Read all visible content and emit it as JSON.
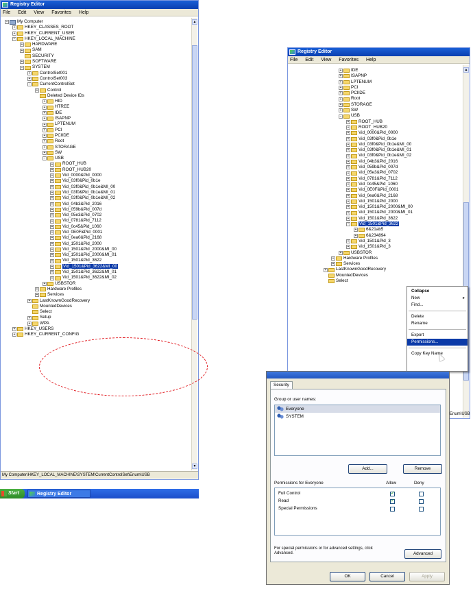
{
  "left_window": {
    "title": "Registry Editor",
    "menu": [
      "File",
      "Edit",
      "View",
      "Favorites",
      "Help"
    ],
    "tree": [
      {
        "label": "My Computer",
        "indent": 0,
        "exp": "-",
        "icon": "pc"
      },
      {
        "label": "HKEY_CLASSES_ROOT",
        "indent": 1,
        "exp": "+"
      },
      {
        "label": "HKEY_CURRENT_USER",
        "indent": 1,
        "exp": "+"
      },
      {
        "label": "HKEY_LOCAL_MACHINE",
        "indent": 1,
        "exp": "-"
      },
      {
        "label": "HARDWARE",
        "indent": 2,
        "exp": "+"
      },
      {
        "label": "SAM",
        "indent": 2,
        "exp": "+"
      },
      {
        "label": "SECURITY",
        "indent": 2,
        "exp": ""
      },
      {
        "label": "SOFTWARE",
        "indent": 2,
        "exp": "+"
      },
      {
        "label": "SYSTEM",
        "indent": 2,
        "exp": "-"
      },
      {
        "label": "ControlSet001",
        "indent": 3,
        "exp": "+"
      },
      {
        "label": "ControlSet003",
        "indent": 3,
        "exp": "+"
      },
      {
        "label": "CurrentControlSet",
        "indent": 3,
        "exp": "-"
      },
      {
        "label": "Control",
        "indent": 4,
        "exp": "+"
      },
      {
        "label": "Deleted Device IDs",
        "indent": 4,
        "exp": ""
      },
      {
        "label": "HID",
        "indent": 5,
        "exp": "+"
      },
      {
        "label": "HTREE",
        "indent": 5,
        "exp": "+"
      },
      {
        "label": "IDE",
        "indent": 5,
        "exp": "+"
      },
      {
        "label": "ISAPNP",
        "indent": 5,
        "exp": "+"
      },
      {
        "label": "LPTENUM",
        "indent": 5,
        "exp": "+"
      },
      {
        "label": "PCI",
        "indent": 5,
        "exp": "+"
      },
      {
        "label": "PCIIDE",
        "indent": 5,
        "exp": "+"
      },
      {
        "label": "Root",
        "indent": 5,
        "exp": "+"
      },
      {
        "label": "STORAGE",
        "indent": 5,
        "exp": "+"
      },
      {
        "label": "SW",
        "indent": 5,
        "exp": "+"
      },
      {
        "label": "USB",
        "indent": 5,
        "exp": "-"
      },
      {
        "label": "ROOT_HUB",
        "indent": 6,
        "exp": "+"
      },
      {
        "label": "ROOT_HUB20",
        "indent": 6,
        "exp": "+"
      },
      {
        "label": "Vid_0000&Pid_0000",
        "indent": 6,
        "exp": "+"
      },
      {
        "label": "Vid_03f0&Pid_0b1e",
        "indent": 6,
        "exp": "+"
      },
      {
        "label": "Vid_03f0&Pid_0b1e&MI_00",
        "indent": 6,
        "exp": "+"
      },
      {
        "label": "Vid_03f0&Pid_0b1e&MI_01",
        "indent": 6,
        "exp": "+"
      },
      {
        "label": "Vid_03f0&Pid_0b1e&MI_02",
        "indent": 6,
        "exp": "+"
      },
      {
        "label": "Vid_04b3&Pid_2016",
        "indent": 6,
        "exp": "+"
      },
      {
        "label": "Vid_059b&Pid_007d",
        "indent": 6,
        "exp": "+"
      },
      {
        "label": "Vid_05e3&Pid_0702",
        "indent": 6,
        "exp": "+"
      },
      {
        "label": "Vid_0781&Pid_7112",
        "indent": 6,
        "exp": "+"
      },
      {
        "label": "Vid_0c45&Pid_1060",
        "indent": 6,
        "exp": "+"
      },
      {
        "label": "Vid_0E0F&Pid_0001",
        "indent": 6,
        "exp": "+"
      },
      {
        "label": "Vid_0ea0&Pid_2168",
        "indent": 6,
        "exp": "+"
      },
      {
        "label": "Vid_1501&Pid_2000",
        "indent": 6,
        "exp": "+"
      },
      {
        "label": "Vid_1501&Pid_2000&MI_00",
        "indent": 6,
        "exp": "+"
      },
      {
        "label": "Vid_1501&Pid_2000&MI_01",
        "indent": 6,
        "exp": "+"
      },
      {
        "label": "Vid_1501&Pid_3622",
        "indent": 6,
        "exp": "+"
      },
      {
        "label": "Vid_1501&Pid_3622&MI_00",
        "indent": 6,
        "exp": "+",
        "selected": true
      },
      {
        "label": "Vid_1501&Pid_3622&MI_01",
        "indent": 6,
        "exp": "+"
      },
      {
        "label": "Vid_1501&Pid_3622&MI_02",
        "indent": 6,
        "exp": "+"
      },
      {
        "label": "USBSTOR",
        "indent": 5,
        "exp": "+"
      },
      {
        "label": "Hardware Profiles",
        "indent": 4,
        "exp": "+"
      },
      {
        "label": "Services",
        "indent": 4,
        "exp": "+"
      },
      {
        "label": "LastKnownGoodRecovery",
        "indent": 3,
        "exp": "+"
      },
      {
        "label": "MountedDevices",
        "indent": 3,
        "exp": ""
      },
      {
        "label": "Select",
        "indent": 3,
        "exp": ""
      },
      {
        "label": "Setup",
        "indent": 3,
        "exp": "+"
      },
      {
        "label": "WPA",
        "indent": 3,
        "exp": "+"
      },
      {
        "label": "HKEY_USERS",
        "indent": 1,
        "exp": "+"
      },
      {
        "label": "HKEY_CURRENT_CONFIG",
        "indent": 1,
        "exp": "+"
      }
    ],
    "status": "My Computer\\HKEY_LOCAL_MACHINE\\SYSTEM\\CurrentControlSet\\Enum\\USB",
    "start_label": "Start",
    "taskbar_item": "Registry Editor"
  },
  "right_window": {
    "title": "Registry Editor",
    "menu": [
      "File",
      "Edit",
      "View",
      "Favorites",
      "Help"
    ],
    "tree": [
      {
        "label": "IDE",
        "indent": 1,
        "exp": "+"
      },
      {
        "label": "ISAPNP",
        "indent": 1,
        "exp": "+"
      },
      {
        "label": "LPTENUM",
        "indent": 1,
        "exp": "+"
      },
      {
        "label": "PCI",
        "indent": 1,
        "exp": "+"
      },
      {
        "label": "PCIIDE",
        "indent": 1,
        "exp": "+"
      },
      {
        "label": "Root",
        "indent": 1,
        "exp": "+"
      },
      {
        "label": "STORAGE",
        "indent": 1,
        "exp": "+"
      },
      {
        "label": "SW",
        "indent": 1,
        "exp": "+"
      },
      {
        "label": "USB",
        "indent": 1,
        "exp": "-"
      },
      {
        "label": "ROOT_HUB",
        "indent": 2,
        "exp": "+"
      },
      {
        "label": "ROOT_HUB20",
        "indent": 2,
        "exp": "+"
      },
      {
        "label": "Vid_0000&Pid_0000",
        "indent": 2,
        "exp": "+"
      },
      {
        "label": "Vid_03f0&Pid_0b1e",
        "indent": 2,
        "exp": "+"
      },
      {
        "label": "Vid_03f0&Pid_0b1e&MI_00",
        "indent": 2,
        "exp": "+"
      },
      {
        "label": "Vid_03f0&Pid_0b1e&MI_01",
        "indent": 2,
        "exp": "+"
      },
      {
        "label": "Vid_03f0&Pid_0b1e&MI_02",
        "indent": 2,
        "exp": "+"
      },
      {
        "label": "Vid_04b3&Pid_2016",
        "indent": 2,
        "exp": "+"
      },
      {
        "label": "Vid_059b&Pid_007d",
        "indent": 2,
        "exp": "+"
      },
      {
        "label": "Vid_05e3&Pid_0702",
        "indent": 2,
        "exp": "+"
      },
      {
        "label": "Vid_0781&Pid_7112",
        "indent": 2,
        "exp": "+"
      },
      {
        "label": "Vid_0c45&Pid_1060",
        "indent": 2,
        "exp": "+"
      },
      {
        "label": "Vid_0E0F&Pid_0001",
        "indent": 2,
        "exp": "+"
      },
      {
        "label": "Vid_0ea0&Pid_2168",
        "indent": 2,
        "exp": "+"
      },
      {
        "label": "Vid_1501&Pid_2000",
        "indent": 2,
        "exp": "+"
      },
      {
        "label": "Vid_1501&Pid_2000&MI_00",
        "indent": 2,
        "exp": "+"
      },
      {
        "label": "Vid_1501&Pid_2000&MI_01",
        "indent": 2,
        "exp": "+"
      },
      {
        "label": "Vid_1501&Pid_3622",
        "indent": 2,
        "exp": "+"
      },
      {
        "label": "Vid_1501&Pid_3622",
        "indent": 2,
        "exp": "-",
        "selected": true
      },
      {
        "label": "6&21ab5",
        "indent": 3,
        "exp": "+"
      },
      {
        "label": "6&234894",
        "indent": 3,
        "exp": "+"
      },
      {
        "label": "Vid_1501&Pid_3",
        "indent": 2,
        "exp": "+"
      },
      {
        "label": "Vid_1501&Pid_3",
        "indent": 2,
        "exp": "+"
      },
      {
        "label": "USBSTOR",
        "indent": 1,
        "exp": "+"
      },
      {
        "label": "Hardware Profiles",
        "indent": 0,
        "exp": "+"
      },
      {
        "label": "Services",
        "indent": 0,
        "exp": "+"
      },
      {
        "label": "LastKnownGoodRecovery",
        "indent": -1,
        "exp": "+"
      },
      {
        "label": "MountedDevices",
        "indent": -1,
        "exp": ""
      },
      {
        "label": "Select",
        "indent": -1,
        "exp": ""
      }
    ],
    "status_fragment": "Enum\\USB"
  },
  "context_menu": {
    "items": [
      {
        "label": "Collapse",
        "bold": true
      },
      {
        "label": "New",
        "submenu": true
      },
      {
        "label": "Find..."
      },
      {
        "sep": true
      },
      {
        "label": "Delete"
      },
      {
        "label": "Rename"
      },
      {
        "sep": true
      },
      {
        "label": "Export"
      },
      {
        "label": "Permissions...",
        "highlighted": true
      },
      {
        "sep": true
      },
      {
        "label": "Copy Key Name"
      }
    ]
  },
  "permissions_dialog": {
    "tab": "Security",
    "group_label": "Group or user names:",
    "users": [
      "Everyone",
      "SYSTEM"
    ],
    "add_label": "Add...",
    "remove_label": "Remove",
    "perm_header": "Permissions for Everyone",
    "allow_label": "Allow",
    "deny_label": "Deny",
    "permissions": [
      {
        "name": "Full Control",
        "allow": true,
        "deny": false
      },
      {
        "name": "Read",
        "allow": true,
        "deny": false
      },
      {
        "name": "Special Permissions",
        "allow": false,
        "deny": false
      }
    ],
    "note": "For special permissions or for advanced settings, click Advanced.",
    "advanced_label": "Advanced",
    "ok_label": "OK",
    "cancel_label": "Cancel",
    "apply_label": "Apply"
  }
}
